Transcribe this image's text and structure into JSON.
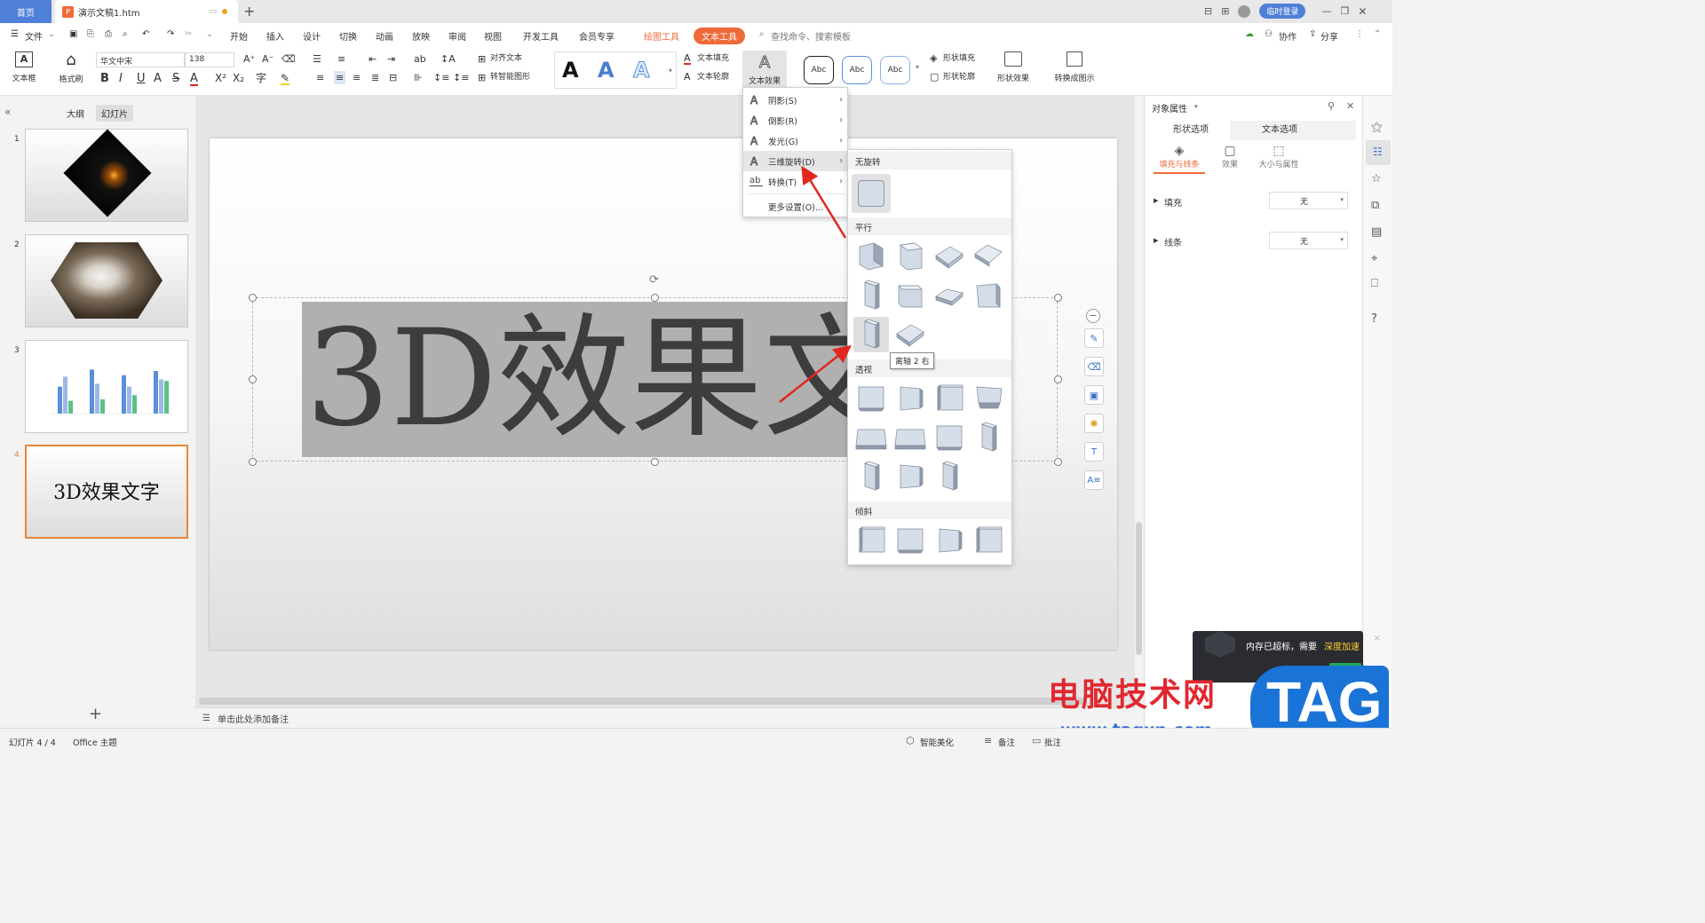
{
  "topbar": {
    "home_tab": "首页",
    "doc_tab": "演示文稿1.htm",
    "login": "临时登录"
  },
  "menubar": {
    "file": "文件",
    "items": [
      "开始",
      "插入",
      "设计",
      "切换",
      "动画",
      "放映",
      "审阅",
      "视图",
      "开发工具",
      "会员专享"
    ],
    "drawing_tools": "绘图工具",
    "text_tools": "文本工具",
    "search_placeholder": "查找命令、搜索模板",
    "collab": "协作",
    "share": "分享"
  },
  "ribbon": {
    "textbox": "文本框",
    "format_painter": "格式刷",
    "font_name": "华文中宋",
    "font_size": "138",
    "align_text": "对齐文本",
    "smart_shape": "转智能图形",
    "text_fill": "文本填充",
    "text_outline": "文本轮廓",
    "text_effects": "文本效果",
    "shape_style_label": "Abc",
    "shape_fill": "形状填充",
    "shape_outline": "形状轮廓",
    "shape_effects": "形状效果",
    "convert_diagram": "转换成图示"
  },
  "leftpanel": {
    "tab_outline": "大纲",
    "tab_slides": "幻灯片",
    "slide_numbers": [
      "1",
      "2",
      "3",
      "4"
    ],
    "slide4_text": "3D效果文字",
    "add_slide": "+"
  },
  "slide": {
    "text": "3D效果文"
  },
  "text_effects_menu": {
    "items": [
      {
        "label": "阴影(S)",
        "icon": "text-a-icon",
        "arrow": "›"
      },
      {
        "label": "倒影(R)",
        "icon": "text-a-icon",
        "arrow": "›"
      },
      {
        "label": "发光(G)",
        "icon": "text-a-icon",
        "arrow": "›"
      },
      {
        "label": "三维旋转(D)",
        "icon": "text-a-icon",
        "arrow": "›"
      },
      {
        "label": "转换(T)",
        "icon": "text-ab-icon",
        "arrow": "›"
      }
    ],
    "more": "更多设置(O)..."
  },
  "rotation_submenu": {
    "no_rotation": "无旋转",
    "parallel": "平行",
    "perspective": "透视",
    "oblique": "倾斜",
    "tooltip": "离轴 2 右"
  },
  "rightpanel": {
    "title": "对象属性",
    "tab_shape": "形状选项",
    "tab_text": "文本选项",
    "sub_fill_line": "填充与线条",
    "sub_effects": "效果",
    "sub_size": "大小与属性",
    "fill_label": "填充",
    "fill_value": "无",
    "line_label": "线条",
    "line_value": "无"
  },
  "notes": {
    "placeholder": "单击此处添加备注"
  },
  "statusbar": {
    "slide_info": "幻灯片 4 / 4",
    "theme": "Office 主题",
    "beautify": "智能美化",
    "notes": "备注",
    "comments": "批注"
  },
  "notification": {
    "message": "内存已超标，需要",
    "action": "深度加速"
  },
  "watermark": {
    "site_text": "电脑技术网",
    "url": "www.tagxp.com",
    "tag": "TAG"
  },
  "colors": {
    "accent_blue": "#4f7fd8",
    "text_tool_orange": "#ef6a3a",
    "slide_text_bg": "#b0b0b0",
    "slide_text": "#3d3d3d",
    "active_thumb_border": "#e8883a",
    "red_arrow": "#e0281e",
    "watermark_red": "#e0282e"
  }
}
